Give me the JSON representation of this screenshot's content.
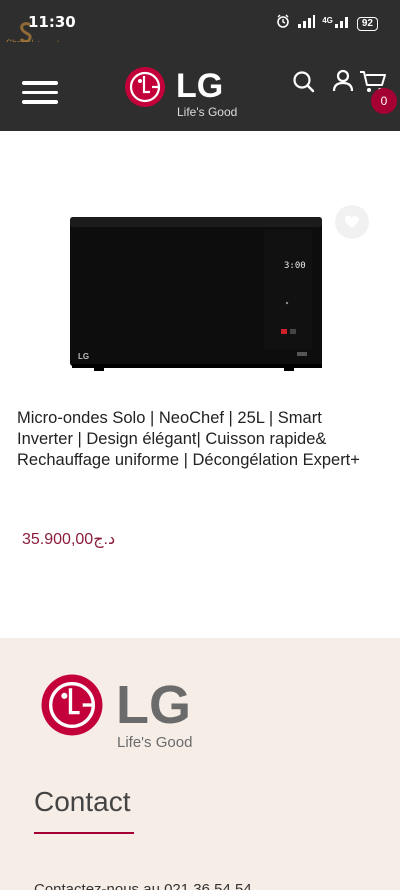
{
  "status_bar": {
    "time": "11:30",
    "battery": "92",
    "network": "4G",
    "watermark": "Shrija | شريجة"
  },
  "header": {
    "brand": "LG",
    "tagline": "Life's Good",
    "cart_count": "0"
  },
  "product": {
    "title": "Micro-ondes Solo | NeoChef | 25L | Smart Inverter | Design élégant| Cuisson rapide& Rechauffage uniforme | Décongélation Expert+",
    "price": "35.900,00د.ج",
    "display_time": "3:00",
    "image_brand": "LG"
  },
  "footer": {
    "brand": "LG",
    "tagline": "Life's Good",
    "contact_title": "Contact",
    "contact_text": "Contactez-nous au 021 36 54 54"
  },
  "colors": {
    "header_bg": "#2e2e2e",
    "lg_red": "#a50034",
    "price": "#8b1d3a",
    "footer_bg": "#f5ede6"
  },
  "icons": [
    "menu-icon",
    "search-icon",
    "user-icon",
    "cart-icon",
    "heart-icon",
    "alarm-icon",
    "signal-icon"
  ]
}
